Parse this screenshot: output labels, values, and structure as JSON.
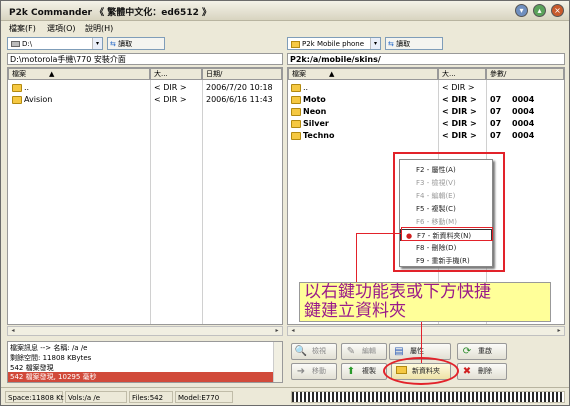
{
  "app": {
    "title": "P2k Commander 《 繁體中文化：ed6512 》"
  },
  "menu": [
    {
      "label": "檔案(F)"
    },
    {
      "label": "選項(O)"
    },
    {
      "label": "說明(H)"
    }
  ],
  "left_pane": {
    "drive": "D:\\",
    "refresh_label": "讀取",
    "path": "D:\\motorola手機\\770 安裝介面",
    "columns": [
      "檔案",
      "大...",
      "日期/"
    ],
    "rows": [
      {
        "name": "..",
        "size": "< DIR >",
        "date": "2006/7/20 10:18"
      },
      {
        "name": "Avision",
        "size": "< DIR >",
        "date": "2006/6/16 11:43"
      }
    ]
  },
  "right_pane": {
    "drive": "P2k Mobile phone",
    "refresh_label": "讀取",
    "path": "P2k:/a/mobile/skins/",
    "columns": [
      "檔案",
      "大...",
      "參數/"
    ],
    "rows": [
      {
        "name": "..",
        "size": "< DIR >",
        "p1": "",
        "p2": ""
      },
      {
        "name": "Moto",
        "size": "< DIR >",
        "p1": "07",
        "p2": "0004"
      },
      {
        "name": "Neon",
        "size": "< DIR >",
        "p1": "07",
        "p2": "0004"
      },
      {
        "name": "Silver",
        "size": "< DIR >",
        "p1": "07",
        "p2": "0004"
      },
      {
        "name": "Techno",
        "size": "< DIR >",
        "p1": "07",
        "p2": "0004"
      }
    ]
  },
  "context_menu": {
    "items": [
      {
        "label": "F2 - 屬性(A)",
        "disabled": false
      },
      {
        "label": "F3 - 檢視(V)",
        "disabled": true
      },
      {
        "label": "F4 - 編輯(E)",
        "disabled": true
      },
      {
        "label": "F5 - 複製(C)",
        "disabled": false
      },
      {
        "label": "F6 - 移動(M)",
        "disabled": true
      },
      {
        "label": "F7 - 新資料夾(N)",
        "disabled": false
      },
      {
        "label": "F8 - 刪除(D)",
        "disabled": false
      },
      {
        "label": "F9 - 重新手機(R)",
        "disabled": false
      }
    ]
  },
  "callout_text": {
    "line1": "以右鍵功能表或下方快捷",
    "line2": "鍵建立資料夾"
  },
  "log": [
    "檔案訊息 --> 名稱: /a /e",
    "剩餘空間: 11808 KBytes",
    "542 檔案發現",
    "542 檔案發現, 10295 毫秒"
  ],
  "buttons": {
    "view": "檢視",
    "edit": "編輯",
    "attrs": "屬性",
    "restart": "重啟",
    "move": "移動",
    "copy": "複製",
    "new_folder": "新資料夾",
    "delete": "刪除"
  },
  "status": {
    "space": "Space:11808 Kt",
    "vols": "Vols:/a /e",
    "files": "Files:542",
    "model": "Model:E770"
  },
  "colors": {
    "highlight": "#e2222a",
    "callout_bg": "#ffff99",
    "callout_text": "#9a1a8a"
  }
}
